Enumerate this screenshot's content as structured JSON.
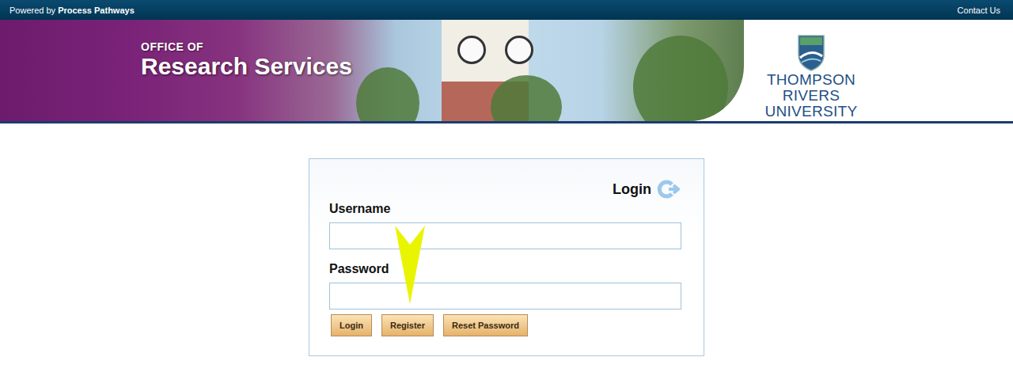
{
  "header": {
    "powered_by": "Powered by",
    "brand": "Process Pathways",
    "contact": "Contact Us"
  },
  "banner": {
    "office": "OFFICE OF",
    "title": "Research Services",
    "university": [
      "THOMPSON RIVERS",
      "UNIVERSITY"
    ]
  },
  "login": {
    "title": "Login",
    "fields": [
      {
        "label": "Username"
      },
      {
        "label": "Password"
      }
    ],
    "buttons": [
      "Login",
      "Register",
      "Reset Password"
    ]
  }
}
